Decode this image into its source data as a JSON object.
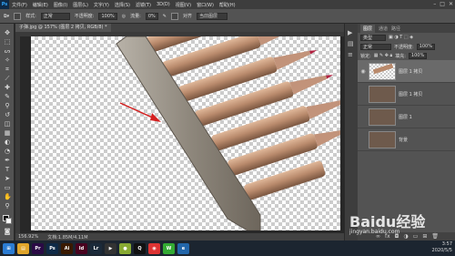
{
  "app": {
    "logo": "Ps"
  },
  "menu": [
    "文件(F)",
    "编辑(E)",
    "图像(I)",
    "图层(L)",
    "文字(Y)",
    "选择(S)",
    "滤镜(T)",
    "3D(D)",
    "视图(V)",
    "窗口(W)",
    "帮助(H)"
  ],
  "window_controls": {
    "minimize": "–",
    "maximize": "□",
    "close": "✕"
  },
  "options": {
    "feather_label": "样式:",
    "feather_value": "正常",
    "opacity_label": "不透明度:",
    "opacity_value": "100%",
    "flow_label": "流量:",
    "flow_value": "0%",
    "sample_label": "对齐",
    "sample_value": "当前图层"
  },
  "document_tab": "子弹.jpg @ 157% (图层 2 拷贝, RGB/8) *",
  "status": {
    "zoom": "156.92%",
    "doc": "文档:1.85M/4.11M"
  },
  "panels": {
    "tabs": [
      "图层",
      "通道",
      "路径"
    ],
    "kind_label": "类型",
    "blend_mode": "正常",
    "opacity_label": "不透明度:",
    "opacity_value": "100%",
    "lock_label": "锁定:",
    "fill_label": "填充:",
    "fill_value": "100%",
    "layers": [
      {
        "name": "图层 1 拷贝",
        "selected": true
      },
      {
        "name": "图层 1 拷贝",
        "selected": false
      },
      {
        "name": "图层 1",
        "selected": false
      },
      {
        "name": "背景",
        "selected": false
      }
    ]
  },
  "watermark": {
    "text": "Baidu经验",
    "url": "jingyan.baidu.com"
  },
  "clock": {
    "time": "3:57",
    "date": "2020/5/5"
  },
  "taskbar": [
    {
      "name": "windows",
      "label": "⊞",
      "color": "#2b7cd3"
    },
    {
      "name": "folder",
      "label": "▤",
      "color": "#e0a52b"
    },
    {
      "name": "premiere",
      "label": "Pr",
      "color": "#2a0a45"
    },
    {
      "name": "photoshop",
      "label": "Ps",
      "color": "#0f2a47"
    },
    {
      "name": "illustrator",
      "label": "Ai",
      "color": "#3a1a00"
    },
    {
      "name": "indesign",
      "label": "Id",
      "color": "#49021f"
    },
    {
      "name": "lightroom",
      "label": "Lr",
      "color": "#1b2a3a"
    },
    {
      "name": "media",
      "label": "▶",
      "color": "#333"
    },
    {
      "name": "photo-app",
      "label": "●",
      "color": "#8a3"
    },
    {
      "name": "qq",
      "label": "Q",
      "color": "#111"
    },
    {
      "name": "chrome",
      "label": "◉",
      "color": "#d33"
    },
    {
      "name": "wechat",
      "label": "W",
      "color": "#3a3"
    },
    {
      "name": "browser",
      "label": "e",
      "color": "#26a"
    }
  ]
}
